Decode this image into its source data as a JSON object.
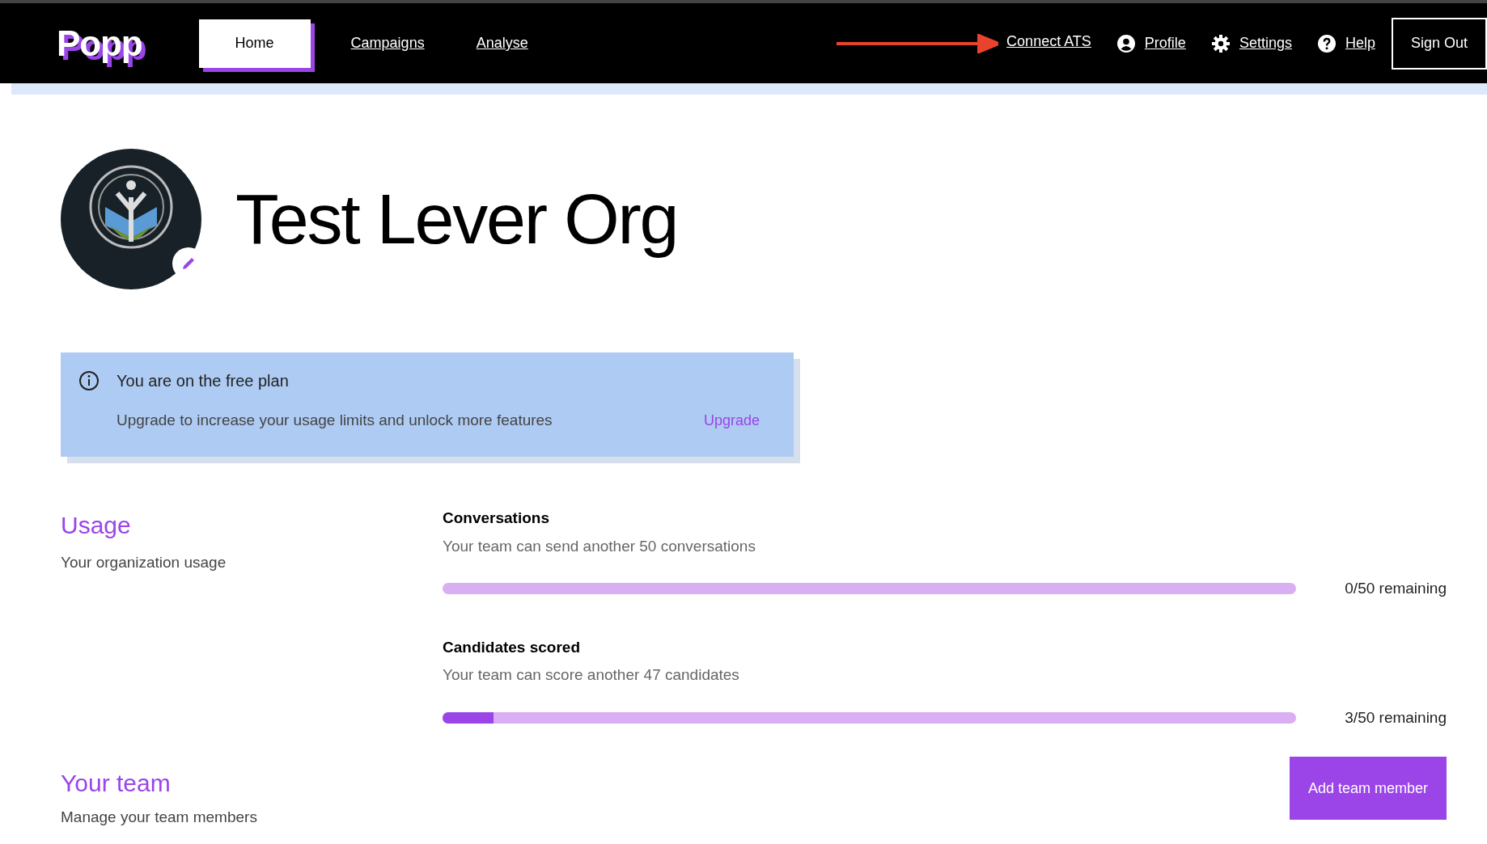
{
  "nav": {
    "brand": "Popp",
    "tabs": [
      {
        "label": "Home",
        "selected": true
      },
      {
        "label": "Campaigns",
        "selected": false
      },
      {
        "label": "Analyse",
        "selected": false
      }
    ],
    "links": [
      {
        "label": "Connect ATS",
        "kind": "arrow"
      },
      {
        "label": "Profile",
        "kind": "user"
      },
      {
        "label": "Settings",
        "kind": "gear"
      },
      {
        "label": "Help",
        "kind": "help"
      }
    ],
    "sign_out": "Sign Out"
  },
  "org": {
    "name": "Test Lever Org"
  },
  "plan_banner": {
    "title": "You are on the free plan",
    "message": "Upgrade to increase your usage limits and unlock more features",
    "action": "Upgrade"
  },
  "usage": {
    "title": "Usage",
    "subtitle": "Your organization usage",
    "meters": [
      {
        "name": "Conversations",
        "description": "Your team can send another 50 conversations",
        "level": 0,
        "reading": "0/50 remaining"
      },
      {
        "name": "Candidates scored",
        "description": "Your team can score another 47 candidates",
        "level": 0.06,
        "reading": "3/50 remaining"
      }
    ]
  },
  "team": {
    "title": "Your team",
    "subtitle": "Manage your team members",
    "button": "Add team member"
  }
}
